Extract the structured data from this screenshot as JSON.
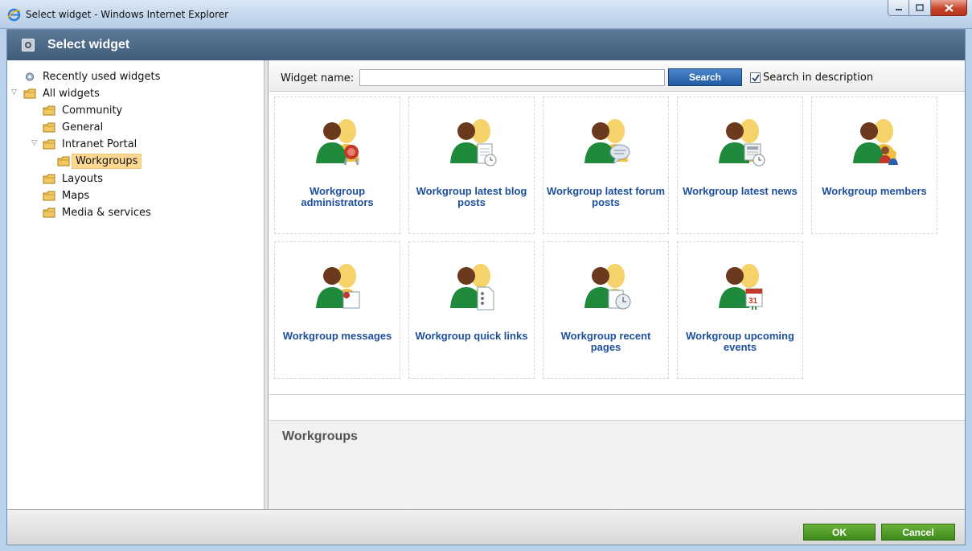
{
  "browser": {
    "title": "Select widget - Windows Internet Explorer",
    "icon": "ie-icon"
  },
  "dialog": {
    "title": "Select widget"
  },
  "tree": {
    "items": [
      {
        "label": "Recently used widgets",
        "icon": "gear-folder-icon"
      },
      {
        "label": "All widgets",
        "icon": "folder-icon",
        "expanded": true
      },
      {
        "label": "Community",
        "icon": "folder-icon"
      },
      {
        "label": "General",
        "icon": "folder-icon"
      },
      {
        "label": "Intranet Portal",
        "icon": "folder-icon",
        "expanded": true
      },
      {
        "label": "Workgroups",
        "icon": "folder-icon",
        "selected": true
      },
      {
        "label": "Layouts",
        "icon": "folder-icon"
      },
      {
        "label": "Maps",
        "icon": "folder-icon"
      },
      {
        "label": "Media & services",
        "icon": "folder-icon"
      }
    ]
  },
  "search": {
    "label": "Widget name:",
    "value": "",
    "button": "Search",
    "checkbox_label": "Search in description",
    "checkbox_checked": true
  },
  "widgets": [
    {
      "label": "Workgroup administrators",
      "overlay": "badge"
    },
    {
      "label": "Workgroup latest blog posts",
      "overlay": "document-clock"
    },
    {
      "label": "Workgroup latest forum posts",
      "overlay": "speech-bubble"
    },
    {
      "label": "Workgroup latest news",
      "overlay": "newspaper-clock"
    },
    {
      "label": "Workgroup members",
      "overlay": "people"
    },
    {
      "label": "Workgroup messages",
      "overlay": "letter"
    },
    {
      "label": "Workgroup quick links",
      "overlay": "links-page"
    },
    {
      "label": "Workgroup recent pages",
      "overlay": "pages-clock"
    },
    {
      "label": "Workgroup upcoming events",
      "overlay": "calendar"
    }
  ],
  "calendar_day": "31",
  "description": {
    "title": "Workgroups"
  },
  "footer": {
    "ok": "OK",
    "cancel": "Cancel"
  },
  "colors": {
    "accent_blue": "#1d4f9b",
    "header": "#4a6886",
    "ok_green": "#4f9d2a",
    "selection": "#fcd894"
  }
}
